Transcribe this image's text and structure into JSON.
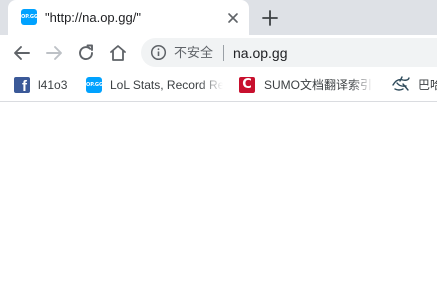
{
  "tab": {
    "title": "\"http://na.op.gg/\"",
    "favicon_text": "OP.GG"
  },
  "omnibox": {
    "security_label": "不安全",
    "url": "na.op.gg"
  },
  "bookmarks": [
    {
      "label": "l41o3",
      "icon": "facebook-icon"
    },
    {
      "label": "LoL Stats, Record Re",
      "icon": "opgg-icon",
      "favicon_text": "OP.GG"
    },
    {
      "label": "SUMO文档翻译索引",
      "icon": "sumo-icon",
      "favicon_text": "C"
    },
    {
      "label": "巴哈",
      "icon": "dragon-icon"
    }
  ],
  "colors": {
    "tabstrip": "#dee1e6",
    "opgg_blue": "#00a2ff",
    "facebook_blue": "#3b5998",
    "sumo_red": "#c8102e"
  }
}
